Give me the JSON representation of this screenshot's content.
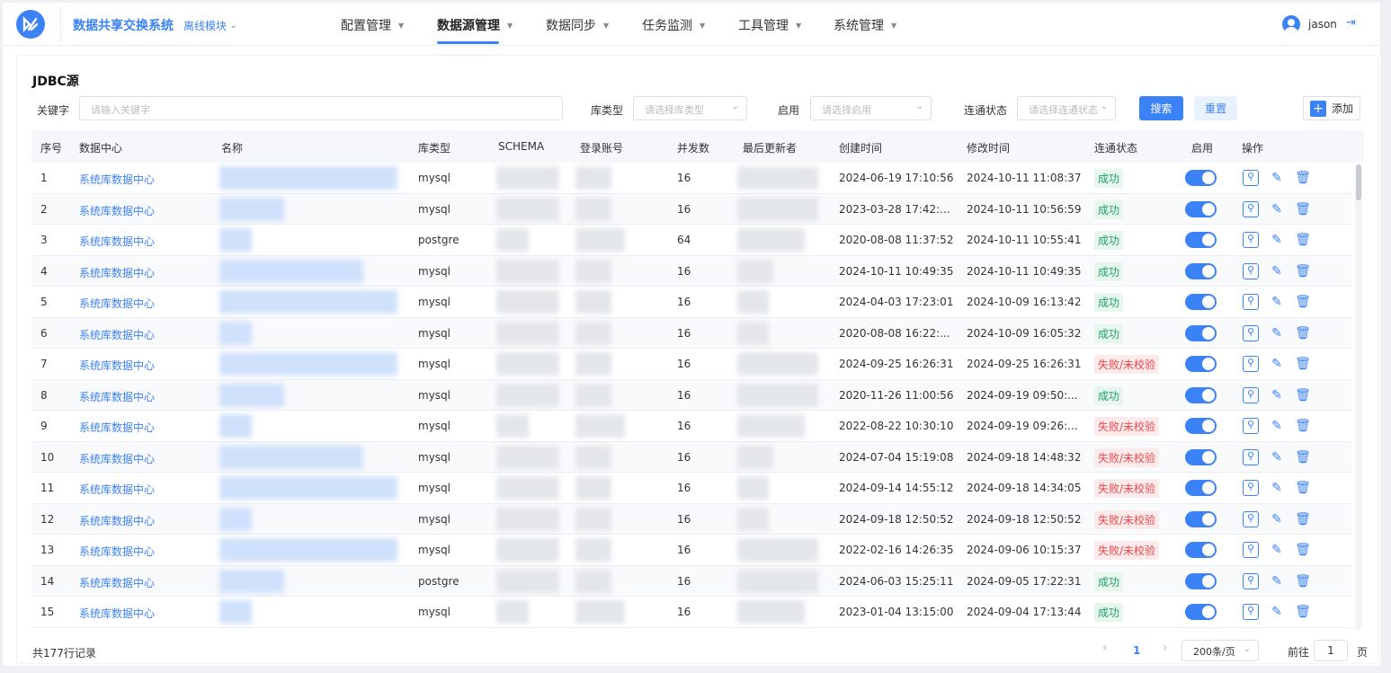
{
  "header": {
    "app_title": "数据共享交换系统",
    "module": "离线模块",
    "nav": [
      {
        "label": "配置管理"
      },
      {
        "label": "数据源管理"
      },
      {
        "label": "数据同步"
      },
      {
        "label": "任务监测"
      },
      {
        "label": "工具管理"
      },
      {
        "label": "系统管理"
      }
    ],
    "active_nav": "数据源管理",
    "user": "jason"
  },
  "page": {
    "title": "JDBC源"
  },
  "filters": {
    "keyword_label": "关键字",
    "keyword_placeholder": "请输入关键字",
    "dbtype_label": "库类型",
    "dbtype_placeholder": "请选择库类型",
    "enabled_label": "启用",
    "enabled_placeholder": "请选择启用",
    "conn_label": "连通状态",
    "conn_placeholder": "请选择连通状态",
    "search_button": "搜索",
    "reset_button": "重置",
    "add_button": "添加"
  },
  "table": {
    "columns": [
      "序号",
      "数据中心",
      "名称",
      "库类型",
      "SCHEMA",
      "登录账号",
      "并发数",
      "最后更新者",
      "创建时间",
      "修改时间",
      "连通状态",
      "启用",
      "操作"
    ],
    "rows": [
      {
        "no": "1",
        "center": "系统库数据中心",
        "dbtype": "mysql",
        "concurrency": "16",
        "created": "2024-06-19 17:10:56",
        "modified": "2024-10-11 11:08:37",
        "status": "成功"
      },
      {
        "no": "2",
        "center": "系统库数据中心",
        "dbtype": "mysql",
        "concurrency": "16",
        "created": "2023-03-28 17:42:...",
        "modified": "2024-10-11 10:56:59",
        "status": "成功"
      },
      {
        "no": "3",
        "center": "系统库数据中心",
        "dbtype": "postgre",
        "concurrency": "64",
        "created": "2020-08-08 11:37:52",
        "modified": "2024-10-11 10:55:41",
        "status": "成功"
      },
      {
        "no": "4",
        "center": "系统库数据中心",
        "dbtype": "mysql",
        "concurrency": "16",
        "created": "2024-10-11 10:49:35",
        "modified": "2024-10-11 10:49:35",
        "status": "成功"
      },
      {
        "no": "5",
        "center": "系统库数据中心",
        "dbtype": "mysql",
        "concurrency": "16",
        "created": "2024-04-03 17:23:01",
        "modified": "2024-10-09 16:13:42",
        "status": "成功"
      },
      {
        "no": "6",
        "center": "系统库数据中心",
        "dbtype": "mysql",
        "concurrency": "16",
        "created": "2020-08-08 16:22:...",
        "modified": "2024-10-09 16:05:32",
        "status": "成功"
      },
      {
        "no": "7",
        "center": "系统库数据中心",
        "dbtype": "mysql",
        "concurrency": "16",
        "created": "2024-09-25 16:26:31",
        "modified": "2024-09-25 16:26:31",
        "status": "失败/未校验"
      },
      {
        "no": "8",
        "center": "系统库数据中心",
        "dbtype": "mysql",
        "concurrency": "16",
        "created": "2020-11-26 11:00:56",
        "modified": "2024-09-19 09:50:...",
        "status": "成功"
      },
      {
        "no": "9",
        "center": "系统库数据中心",
        "dbtype": "mysql",
        "concurrency": "16",
        "created": "2022-08-22 10:30:10",
        "modified": "2024-09-19 09:26:...",
        "status": "失败/未校验"
      },
      {
        "no": "10",
        "center": "系统库数据中心",
        "dbtype": "mysql",
        "concurrency": "16",
        "created": "2024-07-04 15:19:08",
        "modified": "2024-09-18 14:48:32",
        "status": "失败/未校验"
      },
      {
        "no": "11",
        "center": "系统库数据中心",
        "dbtype": "mysql",
        "concurrency": "16",
        "created": "2024-09-14 14:55:12",
        "modified": "2024-09-18 14:34:05",
        "status": "失败/未校验"
      },
      {
        "no": "12",
        "center": "系统库数据中心",
        "dbtype": "mysql",
        "concurrency": "16",
        "created": "2024-09-18 12:50:52",
        "modified": "2024-09-18 12:50:52",
        "status": "失败/未校验"
      },
      {
        "no": "13",
        "center": "系统库数据中心",
        "dbtype": "mysql",
        "concurrency": "16",
        "created": "2022-02-16 14:26:35",
        "modified": "2024-09-06 10:15:37",
        "status": "失败/未校验"
      },
      {
        "no": "14",
        "center": "系统库数据中心",
        "dbtype": "postgre",
        "concurrency": "16",
        "created": "2024-06-03 15:25:11",
        "modified": "2024-09-05 17:22:31",
        "status": "成功"
      },
      {
        "no": "15",
        "center": "系统库数据中心",
        "dbtype": "mysql",
        "concurrency": "16",
        "created": "2023-01-04 13:15:00",
        "modified": "2024-09-04 17:13:44",
        "status": "成功"
      }
    ]
  },
  "footer": {
    "total": "共177行记录",
    "current_page": "1",
    "page_size": "200条/页",
    "goto_label": "前往",
    "goto_value": "1",
    "page_unit": "页"
  }
}
